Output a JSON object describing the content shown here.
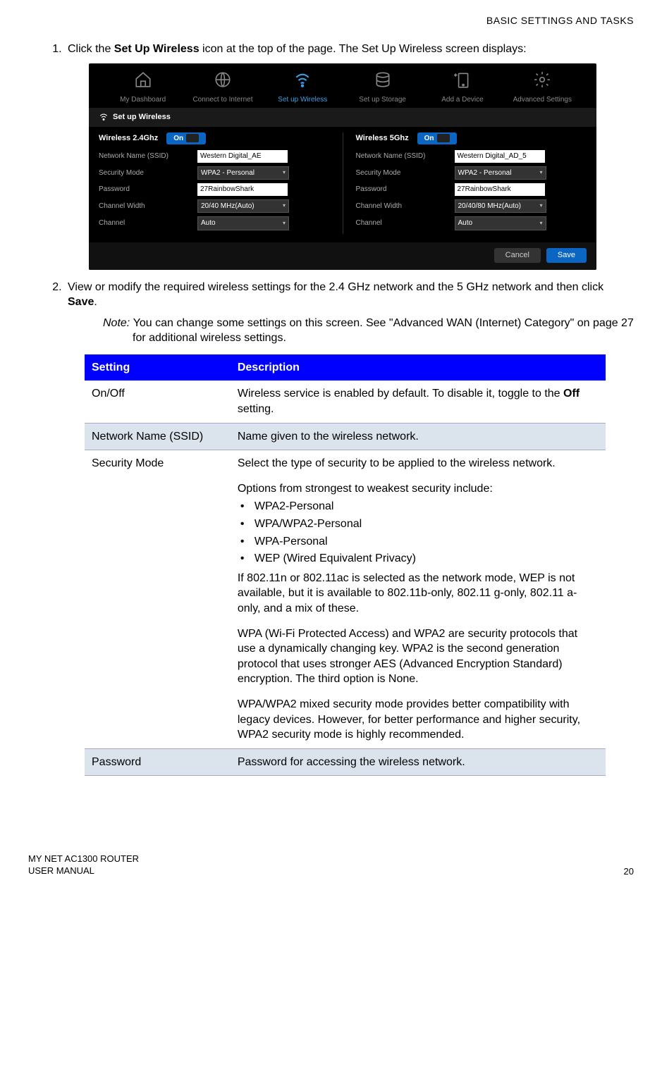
{
  "header": {
    "section": "BASIC SETTINGS AND TASKS"
  },
  "step1": {
    "prefix": "Click the ",
    "bold": "Set Up Wireless",
    "suffix": " icon at the top of the page. The Set Up Wireless screen displays:"
  },
  "screenshot": {
    "nav": {
      "dashboard": "My Dashboard",
      "connect": "Connect to Internet",
      "wireless": "Set up Wireless",
      "storage": "Set up Storage",
      "device": "Add a Device",
      "advanced": "Advanced Settings"
    },
    "subtitle": "Set up Wireless",
    "col24": {
      "title": "Wireless 2.4Ghz",
      "toggle": "On",
      "ssid_label": "Network Name (SSID)",
      "ssid_value": "Western Digital_AE",
      "sec_label": "Security Mode",
      "sec_value": "WPA2 - Personal",
      "pw_label": "Password",
      "pw_value": "27RainbowShark",
      "cw_label": "Channel Width",
      "cw_value": "20/40 MHz(Auto)",
      "ch_label": "Channel",
      "ch_value": "Auto"
    },
    "col5": {
      "title": "Wireless 5Ghz",
      "toggle": "On",
      "ssid_label": "Network Name (SSID)",
      "ssid_value": "Western Digital_AD_5",
      "sec_label": "Security Mode",
      "sec_value": "WPA2 - Personal",
      "pw_label": "Password",
      "pw_value": "27RainbowShark",
      "cw_label": "Channel Width",
      "cw_value": "20/40/80 MHz(Auto)",
      "ch_label": "Channel",
      "ch_value": "Auto"
    },
    "buttons": {
      "cancel": "Cancel",
      "save": "Save"
    }
  },
  "step2": {
    "prefix": "View or modify the required wireless settings for the 2.4 GHz network and the 5 GHz network and then click ",
    "bold": "Save",
    "suffix": "."
  },
  "note": {
    "label": "Note:",
    "text": "You can change some settings on this screen. See \"Advanced WAN (Internet) Category\" on page 27 for additional wireless settings."
  },
  "table": {
    "h1": "Setting",
    "h2": "Description",
    "r1": {
      "setting": "On/Off",
      "desc_pre": "Wireless service is enabled by default. To disable it, toggle to the ",
      "desc_bold": "Off",
      "desc_post": " setting."
    },
    "r2": {
      "setting": "Network Name (SSID)",
      "desc": "Name given to the wireless network."
    },
    "r3": {
      "setting": "Security Mode",
      "p1": "Select the type of security to be applied to the wireless network.",
      "p2": "Options from strongest to weakest security include:",
      "opt1": "WPA2-Personal",
      "opt2": "WPA/WPA2-Personal",
      "opt3": "WPA-Personal",
      "opt4": "WEP (Wired Equivalent Privacy)",
      "p3": "If 802.11n or 802.11ac is selected as the network mode, WEP is not available, but it is available to 802.11b-only, 802.11 g-only, 802.11 a-only, and a mix of these.",
      "p4": "WPA (Wi-Fi Protected Access) and WPA2 are security protocols that use a dynamically changing key. WPA2 is the second generation protocol that uses stronger AES (Advanced Encryption Standard) encryption. The third option is None.",
      "p5": "WPA/WPA2 mixed security mode provides better compatibility with legacy devices. However, for better performance and higher security, WPA2 security mode is highly recommended."
    },
    "r4": {
      "setting": "Password",
      "desc": "Password for accessing the wireless network."
    }
  },
  "footer": {
    "line1": "MY NET AC1300 ROUTER",
    "line2": "USER MANUAL",
    "page": "20"
  }
}
